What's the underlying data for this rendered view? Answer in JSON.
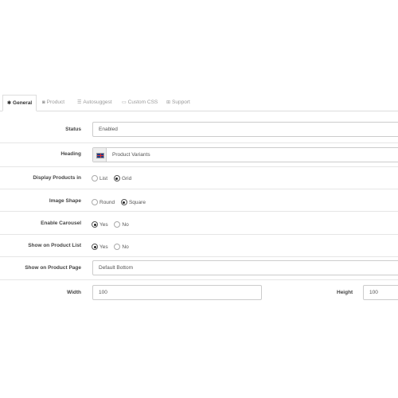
{
  "tabs": [
    {
      "label": "General",
      "icon": "gear-icon",
      "glyph": "✱"
    },
    {
      "label": "Product",
      "icon": "product-icon",
      "glyph": "◙"
    },
    {
      "label": "Autosuggest",
      "icon": "list-icon",
      "glyph": "☰"
    },
    {
      "label": "Custom CSS",
      "icon": "monitor-icon",
      "glyph": "▭"
    },
    {
      "label": "Support",
      "icon": "support-icon",
      "glyph": "⊞"
    }
  ],
  "form": {
    "status": {
      "label": "Status",
      "value": "Enabled"
    },
    "heading": {
      "label": "Heading",
      "value": "Product Variants",
      "flag_icon": "uk-flag-icon"
    },
    "display_products_in": {
      "label": "Display Products in",
      "options": [
        "List",
        "Grid"
      ],
      "selected": "Grid"
    },
    "image_shape": {
      "label": "Image Shape",
      "options": [
        "Round",
        "Square"
      ],
      "selected": "Square"
    },
    "enable_carousel": {
      "label": "Enable Carousel",
      "options": [
        "Yes",
        "No"
      ],
      "selected": "Yes"
    },
    "show_on_product_list": {
      "label": "Show on Product List",
      "options": [
        "Yes",
        "No"
      ],
      "selected": "Yes"
    },
    "show_on_product_page": {
      "label": "Show on Product Page",
      "value": "Default Bottom"
    },
    "width": {
      "label": "Width",
      "value": "100"
    },
    "height": {
      "label": "Height",
      "value": "100"
    }
  }
}
